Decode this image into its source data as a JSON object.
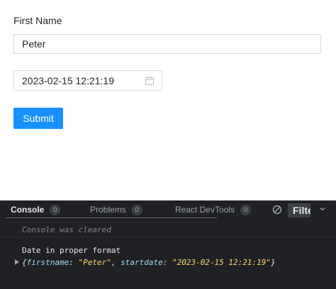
{
  "form": {
    "first_name_label": "First Name",
    "first_name_value": "Peter",
    "date_value": "2023-02-15 12:21:19",
    "submit_label": "Submit"
  },
  "devtools": {
    "tabs": [
      {
        "label": "Console",
        "count": "0"
      },
      {
        "label": "Problems",
        "count": "0"
      },
      {
        "label": "React DevTools",
        "count": "0"
      }
    ],
    "filter_label": "Filte",
    "cleared_message": "Console was cleared",
    "log_message": "Date in proper format",
    "log_object": {
      "open_brace": "{",
      "key1": "firstname",
      "sep1": ": ",
      "val1": "\"Peter\"",
      "comma": ", ",
      "key2": "startdate",
      "sep2": ": ",
      "val2": "\"2023-02-15 12:21:19\"",
      "close_brace": "}"
    }
  },
  "colors": {
    "primary": "#1890ff",
    "console_bg": "#202124",
    "key": "#9cdcfe",
    "string": "#fdd663"
  },
  "icons": [
    "calendar-icon",
    "block-icon",
    "chevron-down-icon",
    "expand-triangle-icon"
  ]
}
